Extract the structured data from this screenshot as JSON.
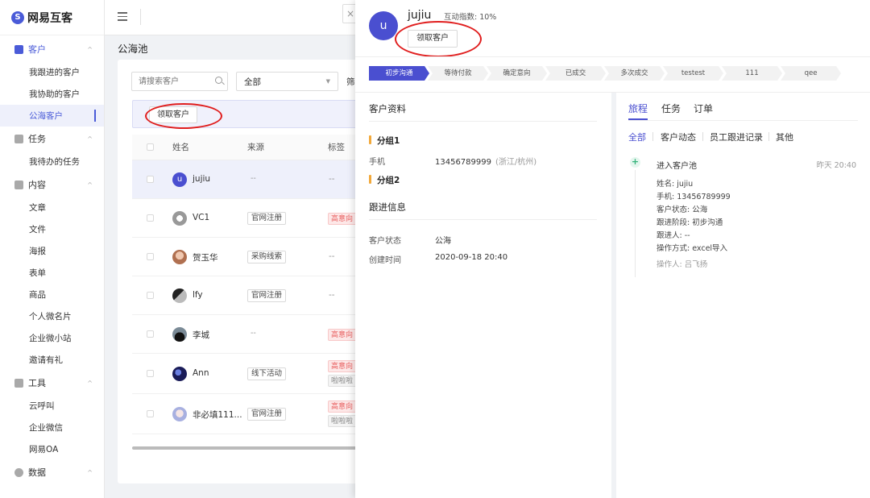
{
  "app": {
    "logo_text": "网易互客"
  },
  "sidebar": {
    "groups": [
      {
        "label": "客户",
        "items": [
          "我跟进的客户",
          "我协助的客户",
          "公海客户"
        ]
      },
      {
        "label": "任务",
        "items": [
          "我待办的任务"
        ]
      },
      {
        "label": "内容",
        "items": [
          "文章",
          "文件",
          "海报",
          "表单",
          "商品",
          "个人微名片",
          "企业微小站",
          "邀请有礼"
        ]
      },
      {
        "label": "工具",
        "items": [
          "云呼叫",
          "企业微信",
          "网易OA"
        ]
      },
      {
        "label": "数据",
        "items": []
      }
    ],
    "active_item": "公海客户"
  },
  "main": {
    "page_title": "公海池",
    "search_placeholder": "请搜索客户",
    "select_value": "全部",
    "filter_label": "筛",
    "claim_button": "领取客户",
    "columns": [
      "姓名",
      "来源",
      "标签"
    ],
    "rows": [
      {
        "avatar": "u",
        "name": "jujiu",
        "source": "--",
        "tags": [
          "--"
        ]
      },
      {
        "avatar": "",
        "name": "VC1",
        "source": "官网注册",
        "tags": [
          "高意向"
        ]
      },
      {
        "avatar": "",
        "name": "贺玉华",
        "source": "采购线索",
        "tags": [
          "--"
        ]
      },
      {
        "avatar": "",
        "name": "lfy",
        "source": "官网注册",
        "tags": [
          "--"
        ]
      },
      {
        "avatar": "",
        "name": "李城",
        "source": "--",
        "tags": [
          "高意向"
        ]
      },
      {
        "avatar": "",
        "name": "Ann",
        "source": "线下活动",
        "tags": [
          "高意向",
          "啦啦啦"
        ]
      },
      {
        "avatar": "",
        "name": "非必填111...",
        "source": "官网注册",
        "tags": [
          "高意向",
          "啦啦啦"
        ]
      }
    ]
  },
  "drawer": {
    "avatar": "u",
    "name": "jujiu",
    "score": "互动指数: 10%",
    "claim_button": "领取客户",
    "stages": [
      "初步沟通",
      "等待付款",
      "确定意向",
      "已成交",
      "多次成交",
      "testest",
      "111",
      "qee"
    ],
    "current_stage": "初步沟通",
    "profile": {
      "title": "客户资料",
      "group1": "分组1",
      "phone_label": "手机",
      "phone_value": "13456789999",
      "phone_location": "(浙江/杭州)",
      "group2": "分组2"
    },
    "follow": {
      "title": "跟进信息",
      "status_label": "客户状态",
      "status_value": "公海",
      "created_label": "创建时间",
      "created_value": "2020-09-18 20:40"
    },
    "tabs": [
      "旅程",
      "任务",
      "订单"
    ],
    "subtabs": [
      "全部",
      "客户动态",
      "员工跟进记录",
      "其他"
    ],
    "timeline": {
      "title": "进入客户池",
      "time": "昨天 20:40",
      "details": [
        "姓名: jujiu",
        "手机: 13456789999",
        "客户状态: 公海",
        "跟进阶段: 初步沟通",
        "跟进人: --",
        "操作方式: excel导入"
      ],
      "operator": "操作人: 吕飞扬"
    }
  },
  "colors": {
    "accent": "#4a4fd0",
    "highlight_red": "#e01e1e",
    "group_marker": "#f2a93b"
  }
}
